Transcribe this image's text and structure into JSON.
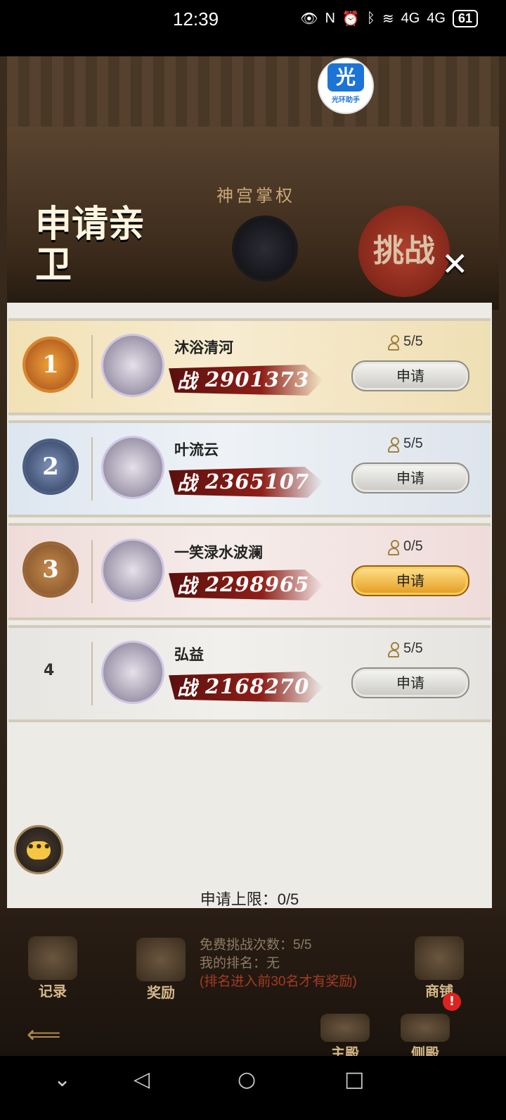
{
  "status_bar": {
    "time": "12:39",
    "network1": "4G",
    "network2": "4G",
    "battery": "61"
  },
  "logo": {
    "char": "光",
    "text": "光环助手"
  },
  "header": {
    "title": "申请亲卫",
    "temple_sign": "神宫掌权",
    "challenge_label": "挑战",
    "close": "✕"
  },
  "rows": [
    {
      "rank": "1",
      "name": "沐浴清河",
      "power_prefix": "战",
      "power": "2901373",
      "quota": "5/5",
      "button": "申请",
      "active": false
    },
    {
      "rank": "2",
      "name": "叶流云",
      "power_prefix": "战",
      "power": "2365107",
      "quota": "5/5",
      "button": "申请",
      "active": false
    },
    {
      "rank": "3",
      "name": "一笑渌水波澜",
      "power_prefix": "战",
      "power": "2298965",
      "quota": "0/5",
      "button": "申请",
      "active": true
    },
    {
      "rank": "4",
      "name": "弘益",
      "power_prefix": "战",
      "power": "2168270",
      "quota": "5/5",
      "button": "申请",
      "active": false
    }
  ],
  "apply_limit": "申请上限：0/5",
  "chat_label": "•••",
  "bottom": {
    "records_label": "记录",
    "rewards_label": "奖励",
    "shop_label": "商铺",
    "main_hall_label": "主殿",
    "side_hall_label": "侧殿",
    "free_challenges": "免费挑战次数：5/5",
    "my_rank": "我的排名：无",
    "reward_hint": "(排名进入前30名才有奖励)",
    "notice_badge": "!"
  },
  "colors": {
    "accent_gold": "#e39b1c",
    "power_red": "#8e1f18",
    "hint_red": "#a33c20"
  }
}
